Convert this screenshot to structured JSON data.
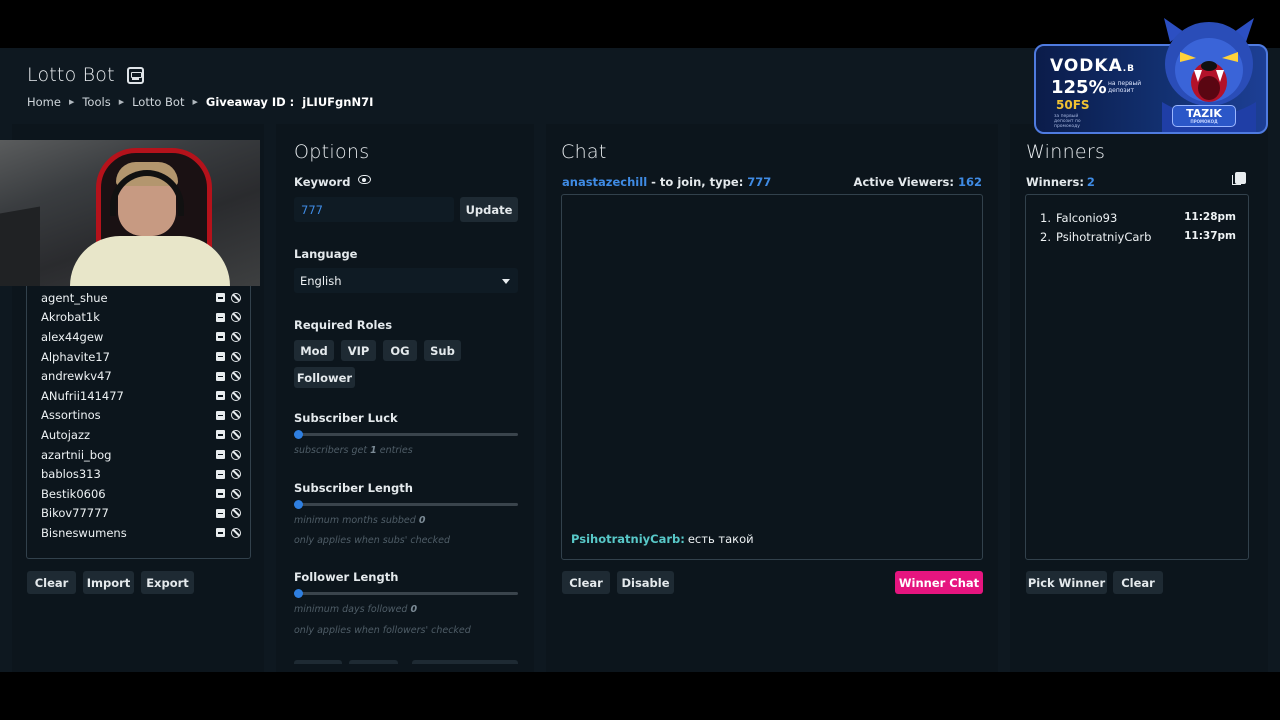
{
  "page": {
    "title": "Lotto Bot"
  },
  "breadcrumb": {
    "items": [
      "Home",
      "Tools",
      "Lotto Bot"
    ],
    "giveaway_label": "Giveaway ID :",
    "giveaway_id": "jLIUFgnN7I"
  },
  "users": {
    "list": [
      "agent_shue",
      "Akrobat1k",
      "alex44gew",
      "Alphavite17",
      "andrewkv47",
      "ANufrii141477",
      "Assortinos",
      "Autojazz",
      "azartnii_bog",
      "bablos313",
      "Bestik0606",
      "Bikov77777",
      "Bisneswumens"
    ],
    "buttons": {
      "clear": "Clear",
      "import": "Import",
      "export": "Export"
    }
  },
  "options": {
    "heading": "Options",
    "keyword_label": "Keyword",
    "keyword_value": "777",
    "update_label": "Update",
    "language_label": "Language",
    "language_value": "English",
    "roles_label": "Required Roles",
    "roles": [
      "Mod",
      "VIP",
      "OG",
      "Sub",
      "Follower"
    ],
    "sub_luck": {
      "label": "Subscriber Luck",
      "hint_pre": "subscribers get",
      "hint_value": "1",
      "hint_post": "entries",
      "level": 0
    },
    "sub_length": {
      "label": "Subscriber Length",
      "hint_pre": "minimum months subbed",
      "hint_value": "0",
      "hint2": "only applies when subs' checked",
      "level": 0
    },
    "follower_length": {
      "label": "Follower Length",
      "hint_pre": "minimum days followed",
      "hint_value": "0",
      "hint2": "only applies when followers' checked",
      "level": 0
    }
  },
  "chat": {
    "heading": "Chat",
    "channel": "anastazechill",
    "join_text": "- to join, type:",
    "keyword": "777",
    "viewers_label": "Active Viewers:",
    "viewers": "162",
    "messages": [
      {
        "from": "PsihotratniyCarb:",
        "text": "есть такой"
      }
    ],
    "buttons": {
      "clear": "Clear",
      "disable": "Disable",
      "winner_chat": "Winner Chat"
    }
  },
  "winners": {
    "heading": "Winners",
    "count_label": "Winners:",
    "count": "2",
    "list": [
      {
        "idx": "1.",
        "name": "Falconio93",
        "time": "11:28pm"
      },
      {
        "idx": "2.",
        "name": "PsihotratniyCarb",
        "time": "11:37pm"
      }
    ],
    "buttons": {
      "pick": "Pick Winner",
      "clear": "Clear"
    }
  },
  "ad": {
    "brand": "VODKA",
    "brand_suffix": ".B",
    "percent": "125%",
    "percent_note": "на первый депозит",
    "freespins": "50FS",
    "fine_print": "за первый депозит по промокоду",
    "promo_code": "TAZIK",
    "promo_label": "ПРОМОКОД"
  },
  "colors": {
    "accent": "#3f8be4",
    "pink": "#e6157f",
    "panel": "#0c151c",
    "chat_user": "#58c8c8"
  }
}
